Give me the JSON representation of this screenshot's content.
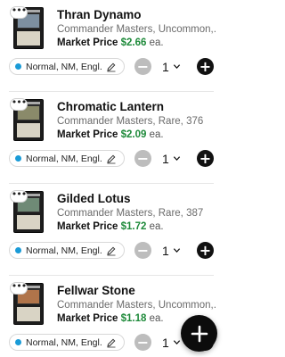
{
  "colors": {
    "price_green": "#1e8a3a",
    "condition_dot": "#1a9bd7",
    "minus_grey": "#bdbdbd",
    "plus_black": "#111111"
  },
  "items": [
    {
      "name": "Thran Dynamo",
      "subtitle": "Commander Masters, Uncommon,...",
      "price_label": "Market Price",
      "price": "$2.66",
      "price_unit": "ea.",
      "condition": "Normal, NM, Engl...",
      "quantity": "1",
      "art_color": "#7d8fa0"
    },
    {
      "name": "Chromatic Lantern",
      "subtitle": "Commander Masters, Rare, 376",
      "price_label": "Market Price",
      "price": "$2.09",
      "price_unit": "ea.",
      "condition": "Normal, NM, Engl...",
      "quantity": "1",
      "art_color": "#8a8a6a"
    },
    {
      "name": "Gilded Lotus",
      "subtitle": "Commander Masters, Rare, 387",
      "price_label": "Market Price",
      "price": "$1.72",
      "price_unit": "ea.",
      "condition": "Normal, NM, Engl...",
      "quantity": "1",
      "art_color": "#6f8a76"
    },
    {
      "name": "Fellwar Stone",
      "subtitle": "Commander Masters, Uncommon,...",
      "price_label": "Market Price",
      "price": "$1.18",
      "price_unit": "ea.",
      "condition": "Normal, NM, Engl...",
      "quantity": "1",
      "art_color": "#b0744a"
    }
  ],
  "fab": {
    "icon": "plus-icon"
  }
}
